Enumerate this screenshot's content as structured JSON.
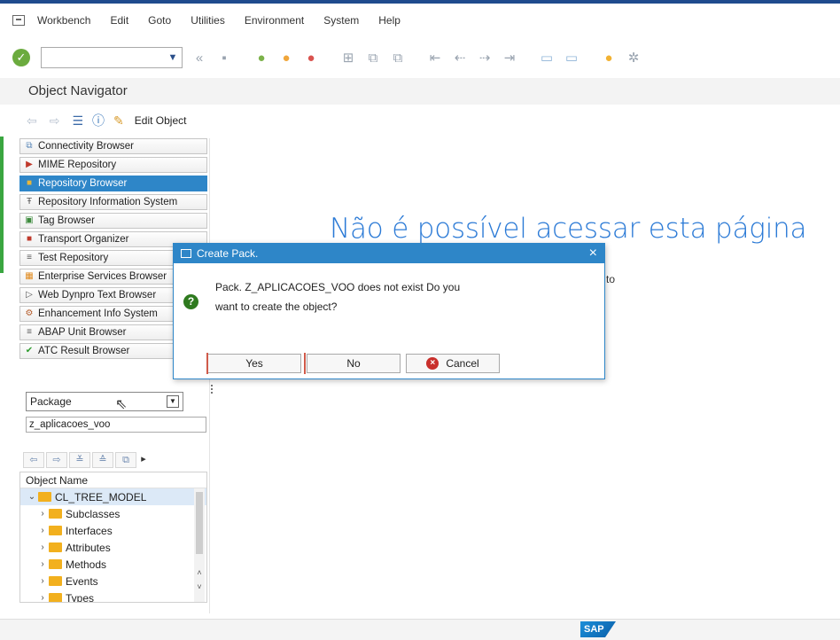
{
  "menubar": {
    "items": [
      "Workbench",
      "Edit",
      "Goto",
      "Utilities",
      "Environment",
      "System",
      "Help"
    ]
  },
  "toolbar": {
    "command_value": ""
  },
  "title": "Object Navigator",
  "app_toolbar": {
    "edit_object_label": "Edit Object"
  },
  "sidebar": {
    "items": [
      {
        "label": "Connectivity Browser",
        "icon": "connectivity-icon",
        "active": false
      },
      {
        "label": "MIME Repository",
        "icon": "mime-icon",
        "active": false
      },
      {
        "label": "Repository Browser",
        "icon": "repository-icon",
        "active": true
      },
      {
        "label": "Repository Information System",
        "icon": "info-system-icon",
        "active": false
      },
      {
        "label": "Tag Browser",
        "icon": "tag-icon",
        "active": false
      },
      {
        "label": "Transport Organizer",
        "icon": "transport-icon",
        "active": false
      },
      {
        "label": "Test Repository",
        "icon": "test-icon",
        "active": false
      },
      {
        "label": "Enterprise Services Browser",
        "icon": "enterprise-icon",
        "active": false
      },
      {
        "label": "Web Dynpro Text Browser",
        "icon": "webdynpro-icon",
        "active": false
      },
      {
        "label": "Enhancement Info System",
        "icon": "enhancement-icon",
        "active": false
      },
      {
        "label": "ABAP Unit Browser",
        "icon": "abap-unit-icon",
        "active": false
      },
      {
        "label": "ATC Result Browser",
        "icon": "atc-icon",
        "active": false
      }
    ]
  },
  "package": {
    "selected": "Package",
    "value": "z_aplicacoes_voo"
  },
  "tree": {
    "header": "Object Name",
    "root": "CL_TREE_MODEL",
    "children": [
      "Subclasses",
      "Interfaces",
      "Attributes",
      "Methods",
      "Events",
      "Types"
    ]
  },
  "content": {
    "error_title": "Não é possível acessar esta página",
    "fragment": "to"
  },
  "dialog": {
    "title": "Create Pack.",
    "message_line1": "Pack. Z_APLICACOES_VOO does not exist Do you",
    "message_line2": "want to create the object?",
    "yes_label": "Yes",
    "no_label": "No",
    "cancel_label": "Cancel",
    "close_glyph": "×"
  },
  "status": {
    "logo_text": "SAP"
  },
  "colors": {
    "accent": "#2e86c8",
    "error_title": "#2b7ad6"
  }
}
